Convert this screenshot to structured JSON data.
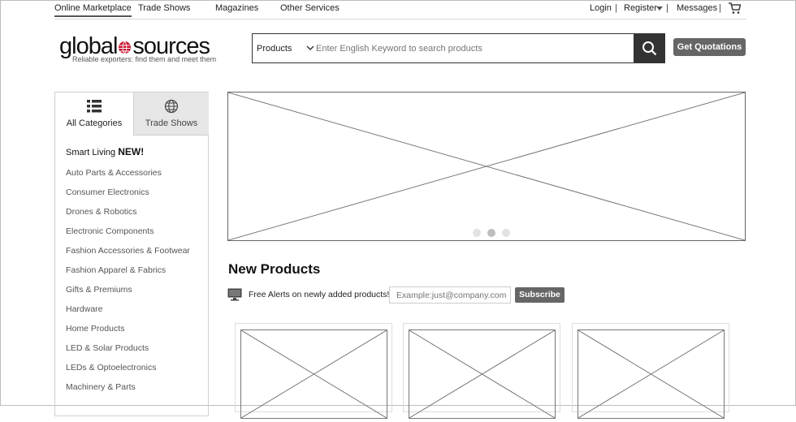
{
  "topnav": {
    "tabs": [
      "Online Marketplace",
      "Trade Shows",
      "Magazines",
      "Other Services"
    ],
    "login": "Login",
    "register": "Register",
    "messages": "Messages",
    "separator": "|"
  },
  "logo": {
    "text_left": "global",
    "text_right": "sources",
    "tagline": "Reliable exporters: find them and meet them"
  },
  "search": {
    "category": "Products",
    "placeholder": "Enter English Keyword to search products"
  },
  "header": {
    "quote_button": "Get Quotations"
  },
  "sidebar": {
    "tabs": [
      "All Categories",
      "Trade Shows"
    ],
    "smart_living": "Smart Living",
    "new_badge": "NEW!",
    "categories": [
      "Auto Parts & Accessories",
      "Consumer Electronics",
      "Drones & Robotics",
      "Electronic Components",
      "Fashion Accessories & Footwear",
      "Fashion Apparel & Fabrics",
      "Gifts & Premiums",
      "Hardware",
      "Home Products",
      "LED & Solar Products",
      "LEDs & Optoelectronics",
      "Machinery & Parts"
    ]
  },
  "banner": {
    "slide_count": 3,
    "active_slide": 2
  },
  "new_products": {
    "title": "New Products",
    "alert_text": "Free Alerts on newly added products!",
    "email_placeholder": "Example:just@company.com",
    "subscribe": "Subscribe"
  },
  "colors": {
    "accent": "#c8102e",
    "button": "#666666",
    "search_button": "#333333"
  }
}
